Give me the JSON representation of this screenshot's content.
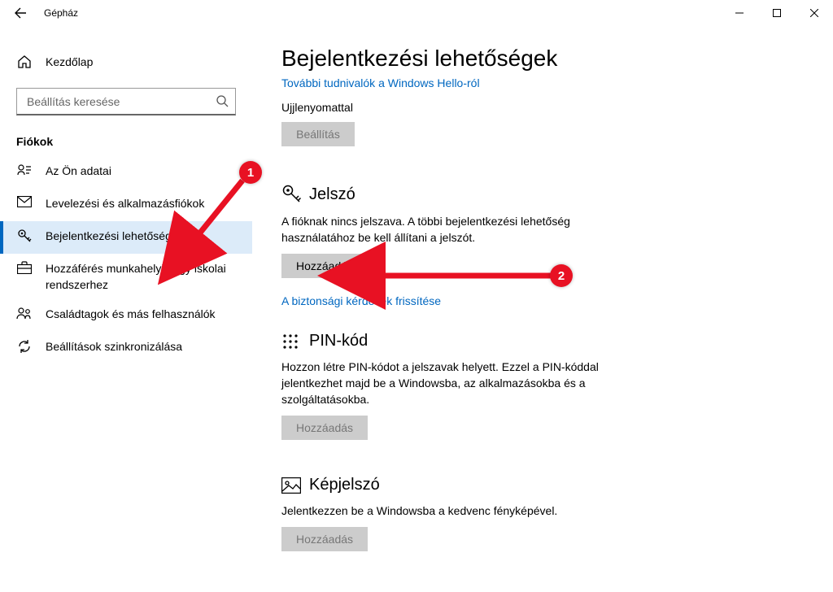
{
  "titlebar": {
    "app_name": "Gépház"
  },
  "sidebar": {
    "home_label": "Kezdőlap",
    "search_placeholder": "Beállítás keresése",
    "group_label": "Fiókok",
    "items": [
      {
        "label": "Az Ön adatai"
      },
      {
        "label": "Levelezési és alkalmazásfiókok"
      },
      {
        "label": "Bejelentkezési lehetőségek"
      },
      {
        "label": "Hozzáférés munkahelyi vagy iskolai rendszerhez"
      },
      {
        "label": "Családtagok és más felhasználók"
      },
      {
        "label": "Beállítások szinkronizálása"
      }
    ]
  },
  "main": {
    "page_title": "Bejelentkezési lehetőségek",
    "hello_more_link": "További tudnivalók a Windows Hello-ról",
    "fingerprint_label": "Ujjlenyomattal",
    "fingerprint_button": "Beállítás",
    "password": {
      "title": "Jelszó",
      "desc": "A fióknak nincs jelszava. A többi bejelentkezési lehetőség használatához be kell állítani a jelszót.",
      "button": "Hozzáadás",
      "security_link": "A biztonsági kérdések frissítése"
    },
    "pin": {
      "title": "PIN-kód",
      "desc": "Hozzon létre PIN-kódot a jelszavak helyett. Ezzel a PIN-kóddal jelentkezhet majd be a Windowsba, az alkalmazásokba és a szolgáltatásokba.",
      "button": "Hozzáadás"
    },
    "picture": {
      "title": "Képjelszó",
      "desc": "Jelentkezzen be a Windowsba a kedvenc fényképével.",
      "button": "Hozzáadás"
    }
  },
  "annotations": {
    "marker1": "1",
    "marker2": "2"
  }
}
